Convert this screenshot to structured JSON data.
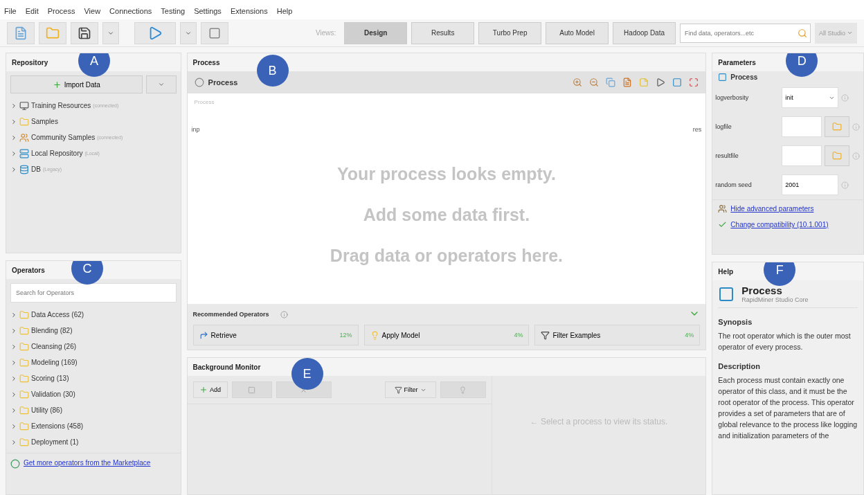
{
  "menu": [
    "File",
    "Edit",
    "Process",
    "View",
    "Connections",
    "Testing",
    "Settings",
    "Extensions",
    "Help"
  ],
  "toolbar": {
    "views_label": "Views:",
    "views": [
      {
        "label": "Design",
        "selected": true
      },
      {
        "label": "Results",
        "selected": false
      },
      {
        "label": "Turbo Prep",
        "selected": false
      },
      {
        "label": "Auto Model",
        "selected": false
      },
      {
        "label": "Hadoop Data",
        "selected": false
      }
    ],
    "search": {
      "placeholder": "Find data, operators...etc"
    },
    "scope": "All Studio"
  },
  "repository": {
    "title": "Repository",
    "callout": "A",
    "import_button": "Import Data",
    "items": [
      {
        "label": "Training Resources",
        "hint": "(connected)",
        "kind": "training"
      },
      {
        "label": "Samples",
        "kind": "folder"
      },
      {
        "label": "Community Samples",
        "hint": "(connected)",
        "kind": "community"
      },
      {
        "label": "Local Repository",
        "hint": "(Local)",
        "kind": "local"
      },
      {
        "label": "DB",
        "hint": "(Legacy)",
        "kind": "db"
      }
    ]
  },
  "operators": {
    "title": "Operators",
    "callout": "C",
    "search": {
      "placeholder": "Search for Operators"
    },
    "items": [
      "Data Access (62)",
      "Blending (82)",
      "Cleansing (26)",
      "Modeling (169)",
      "Scoring (13)",
      "Validation (30)",
      "Utility (86)",
      "Extensions (458)",
      "Deployment (1)"
    ],
    "marketplace_link": "Get more operators from the Marketplace"
  },
  "process": {
    "title": "Process",
    "callout": "B",
    "tab": "Process",
    "canvas_label": "Process",
    "port_in": "inp",
    "port_out": "res",
    "empty_lines": [
      "Your process looks empty.",
      "Add some data first.",
      "Drag data or operators here."
    ],
    "recommended": {
      "title": "Recommended Operators",
      "operators": [
        {
          "label": "Retrieve",
          "share": "12%",
          "kind": "retrieve"
        },
        {
          "label": "Apply Model",
          "share": "4%",
          "kind": "apply"
        },
        {
          "label": "Filter Examples",
          "share": "4%",
          "kind": "filter"
        }
      ]
    }
  },
  "background_monitor": {
    "title": "Background Monitor",
    "callout": "E",
    "add_button": "Add",
    "filter_button": "Filter",
    "status_hint": "← Select a process to view its status."
  },
  "parameters": {
    "title": "Parameters",
    "callout": "D",
    "operator": "Process",
    "rows": [
      {
        "label": "logverbosity",
        "value": "init",
        "kind": "select"
      },
      {
        "label": "logfile",
        "kind": "file"
      },
      {
        "label": "resultfile",
        "kind": "file"
      },
      {
        "label": "random seed",
        "value": "2001",
        "kind": "text"
      }
    ],
    "links": [
      {
        "label": "Hide advanced parameters",
        "kind": "advanced"
      },
      {
        "label": "Change compatibility (10.1.001)",
        "kind": "compat"
      }
    ]
  },
  "help": {
    "title": "Help",
    "callout": "F",
    "operator": "Process",
    "subtitle": "RapidMiner Studio Core",
    "sections": [
      {
        "heading": "Synopsis",
        "text": "The root operator which is the outer most operator of every process."
      },
      {
        "heading": "Description",
        "text": "Each process must contain exactly one operator of this class, and it must be the root operator of the process. This operator provides a set of parameters that are of global relevance to the process like logging and initialization parameters of the"
      }
    ]
  }
}
